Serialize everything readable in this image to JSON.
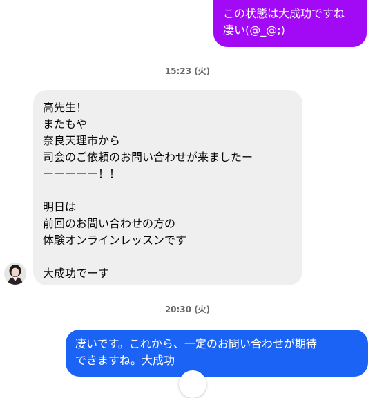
{
  "colors": {
    "outgoing_purple": "#a20af5",
    "outgoing_blue": "#1b63f4",
    "incoming_bg": "#efefef",
    "timestamp_text": "#65676b"
  },
  "messages": [
    {
      "direction": "outgoing",
      "lines": [
        "この状態は大成功ですね",
        "凄い(@_@;)"
      ]
    },
    {
      "direction": "incoming",
      "lines": [
        "高先生！",
        "またもや",
        "奈良天理市から",
        "司会のご依頼のお問い合わせが来ましたー",
        "ーーーーー！！",
        "",
        "明日は",
        "前回のお問い合わせの方の",
        "体験オンラインレッスンです",
        "",
        "大成功でーす"
      ]
    },
    {
      "direction": "outgoing",
      "lines": [
        "凄いです。これから、一定のお問い合わせが期待",
        "できますね。大成功"
      ]
    }
  ],
  "timestamps": [
    "15:23 (火)",
    "20:30 (火)"
  ],
  "icons": {
    "avatar": "contact-avatar",
    "scroll_button": "scroll-down-icon"
  }
}
